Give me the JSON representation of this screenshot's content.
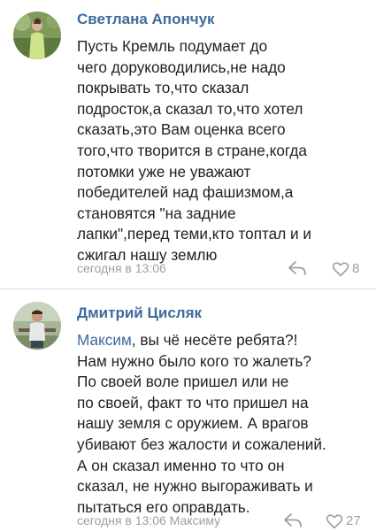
{
  "comments": [
    {
      "author": "Светлана Апончук",
      "text_lines": [
        "Пусть Кремль подумает до",
        "чего доруководились,не надо",
        "покрывать то,что сказал",
        "подросток,а сказал то,что хотел",
        "сказать,это Вам оценка всего",
        "того,что творится в стране,когда",
        "потомки уже не уважают",
        "победителей над фашизмом,а",
        "становятся \"на задние",
        "лапки\",перед теми,кто топтал и и",
        "сжигал нашу землю"
      ],
      "timestamp": "сегодня в 13:06",
      "likes": "8",
      "avatar_icon": "user-photo-avatar"
    },
    {
      "author": "Дмитрий Цисляк",
      "mention": "Максим",
      "text_lines": [
        ", вы чё несёте ребята?!",
        "Нам нужно было кого то жалеть?",
        "По своей воле пришел или не",
        "по своей, факт то что пришел на",
        "нашу земля с оружием. А врагов",
        "убивают без жалости и сожалений.",
        "А он сказал именно то что он",
        "сказал, не нужно выгораживать и",
        "пытаться его оправдать."
      ],
      "timestamp": "сегодня в 13:06 Максиму",
      "likes": "27",
      "avatar_icon": "user-photo-avatar"
    }
  ],
  "colors": {
    "link": "#3e6b9b",
    "text": "#222222",
    "meta": "#9aa0a6",
    "divider": "#dcdfe3"
  },
  "icons": [
    "reply-icon",
    "heart-icon"
  ]
}
